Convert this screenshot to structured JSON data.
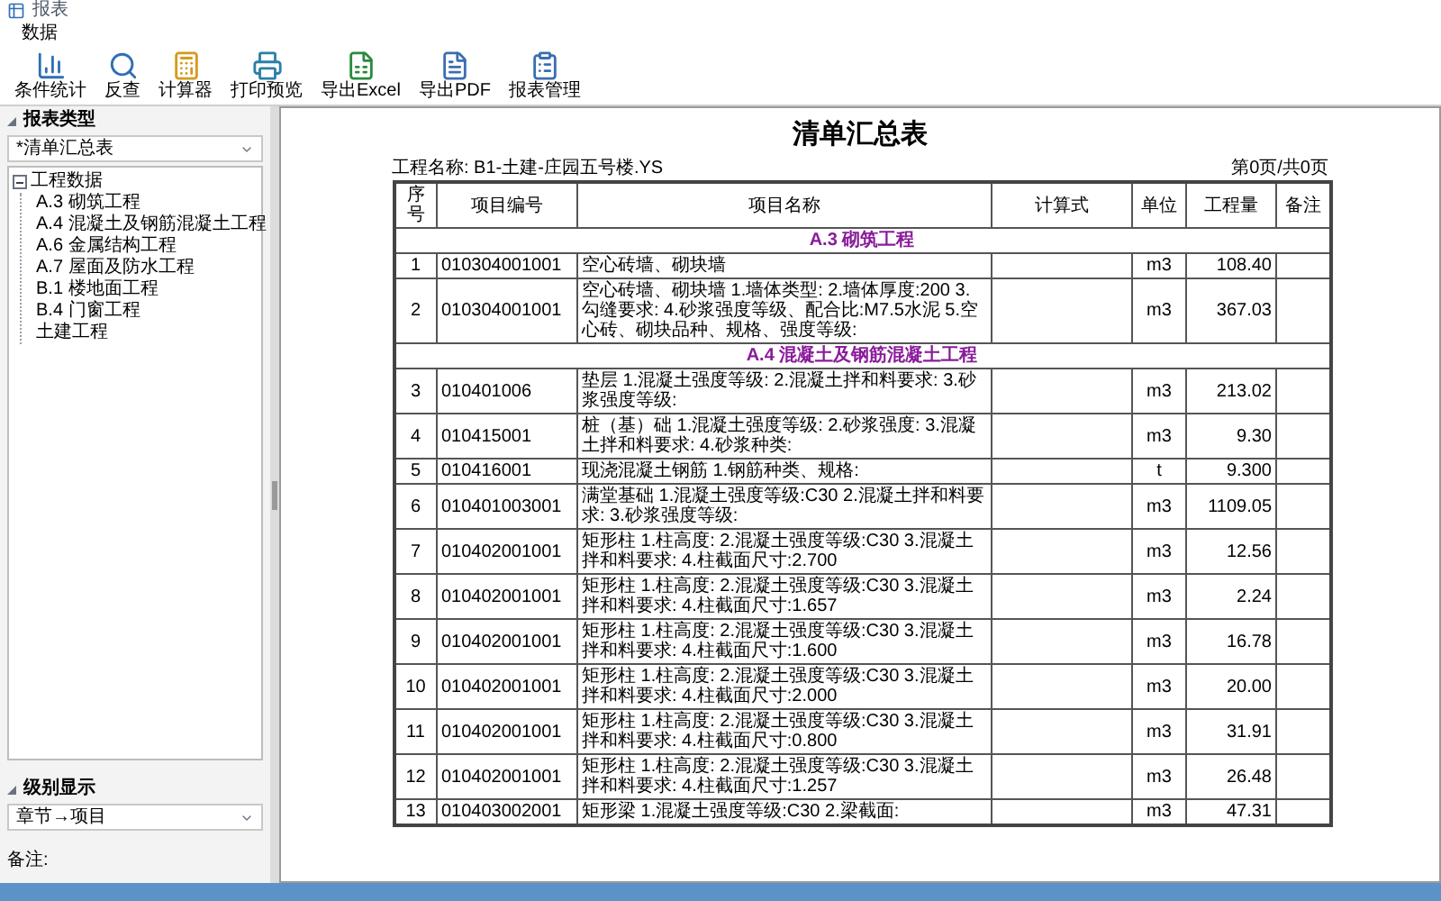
{
  "window": {
    "title": "报表"
  },
  "menu": [
    "数据"
  ],
  "toolbar": [
    {
      "label": "条件统计"
    },
    {
      "label": "反查"
    },
    {
      "label": "计算器"
    },
    {
      "label": "打印预览"
    },
    {
      "label": "导出Excel"
    },
    {
      "label": "导出PDF"
    },
    {
      "label": "报表管理"
    }
  ],
  "report_type_panel": {
    "title": "报表类型",
    "dropdown": "*清单汇总表",
    "tree": [
      {
        "label": "工程数据",
        "expanded": true,
        "children": [
          {
            "label": "A.3 砌筑工程"
          },
          {
            "label": "A.4 混凝土及钢筋混凝土工程"
          },
          {
            "label": "A.6 金属结构工程"
          },
          {
            "label": "A.7 屋面及防水工程"
          },
          {
            "label": "B.1 楼地面工程"
          },
          {
            "label": "B.4 门窗工程"
          },
          {
            "label": "土建工程"
          }
        ]
      }
    ]
  },
  "level_panel": {
    "title": "级别显示",
    "dropdown": "章节→项目",
    "note_label": "备注:"
  },
  "report": {
    "title": "清单汇总表",
    "project": "工程名称: B1-土建-庄园五号楼.YS",
    "page": "第0页/共0页",
    "columns": [
      "序号",
      "项目编号",
      "项目名称",
      "计算式",
      "单位",
      "工程量",
      "备注"
    ],
    "rows": [
      {
        "kind": "section",
        "title": "A.3 砌筑工程"
      },
      {
        "kind": "item",
        "no": "1",
        "code": "010304001001",
        "name": [
          "空心砖墙、砌块墙"
        ],
        "unit": "m3",
        "quantity": "108.40"
      },
      {
        "kind": "item",
        "no": "2",
        "code": "010304001001",
        "name": [
          "空心砖墙、砌块墙",
          "1.墙体类型:",
          "2.墙体厚度:200",
          "3.勾缝要求:",
          "4.砂浆强度等级、配合比:M7.5水泥",
          "5.空心砖、砌块品种、规格、强度等级:"
        ],
        "unit": "m3",
        "quantity": "367.03"
      },
      {
        "kind": "section",
        "title": "A.4 混凝土及钢筋混凝土工程"
      },
      {
        "kind": "item",
        "no": "3",
        "code": "010401006",
        "name": [
          "垫层",
          "1.混凝土强度等级:",
          "2.混凝土拌和料要求:",
          "3.砂浆强度等级:"
        ],
        "unit": "m3",
        "quantity": "213.02"
      },
      {
        "kind": "item",
        "no": "4",
        "code": "010415001",
        "name": [
          "桩（基）础",
          "1.混凝土强度等级:",
          "2.砂浆强度:",
          "3.混凝土拌和料要求:",
          "4.砂浆种类:"
        ],
        "unit": "m3",
        "quantity": "9.30"
      },
      {
        "kind": "item",
        "no": "5",
        "code": "010416001",
        "name": [
          "现浇混凝土钢筋",
          "1.钢筋种类、规格:"
        ],
        "unit": "t",
        "quantity": "9.300"
      },
      {
        "kind": "item",
        "no": "6",
        "code": "010401003001",
        "name": [
          "满堂基础",
          "1.混凝土强度等级:C30",
          "2.混凝土拌和料要求:",
          "3.砂浆强度等级:"
        ],
        "unit": "m3",
        "quantity": "1109.05"
      },
      {
        "kind": "item",
        "no": "7",
        "code": "010402001001",
        "name": [
          "矩形柱",
          "1.柱高度:",
          "2.混凝土强度等级:C30",
          "3.混凝土拌和料要求:",
          "4.柱截面尺寸:2.700"
        ],
        "unit": "m3",
        "quantity": "12.56"
      },
      {
        "kind": "item",
        "no": "8",
        "code": "010402001001",
        "name": [
          "矩形柱",
          "1.柱高度:",
          "2.混凝土强度等级:C30",
          "3.混凝土拌和料要求:",
          "4.柱截面尺寸:1.657"
        ],
        "unit": "m3",
        "quantity": "2.24"
      },
      {
        "kind": "item",
        "no": "9",
        "code": "010402001001",
        "name": [
          "矩形柱",
          "1.柱高度:",
          "2.混凝土强度等级:C30",
          "3.混凝土拌和料要求:",
          "4.柱截面尺寸:1.600"
        ],
        "unit": "m3",
        "quantity": "16.78"
      },
      {
        "kind": "item",
        "no": "10",
        "code": "010402001001",
        "name": [
          "矩形柱",
          "1.柱高度:",
          "2.混凝土强度等级:C30",
          "3.混凝土拌和料要求:",
          "4.柱截面尺寸:2.000"
        ],
        "unit": "m3",
        "quantity": "20.00"
      },
      {
        "kind": "item",
        "no": "11",
        "code": "010402001001",
        "name": [
          "矩形柱",
          "1.柱高度:",
          "2.混凝土强度等级:C30",
          "3.混凝土拌和料要求:",
          "4.柱截面尺寸:0.800"
        ],
        "unit": "m3",
        "quantity": "31.91"
      },
      {
        "kind": "item",
        "no": "12",
        "code": "010402001001",
        "name": [
          "矩形柱",
          "1.柱高度:",
          "2.混凝土强度等级:C30",
          "3.混凝土拌和料要求:",
          "4.柱截面尺寸:1.257"
        ],
        "unit": "m3",
        "quantity": "26.48"
      },
      {
        "kind": "item",
        "no": "13",
        "code": "010403002001",
        "name": [
          "矩形梁",
          "1.混凝土强度等级:C30",
          "2.梁截面:"
        ],
        "unit": "m3",
        "quantity": "47.31"
      }
    ]
  }
}
